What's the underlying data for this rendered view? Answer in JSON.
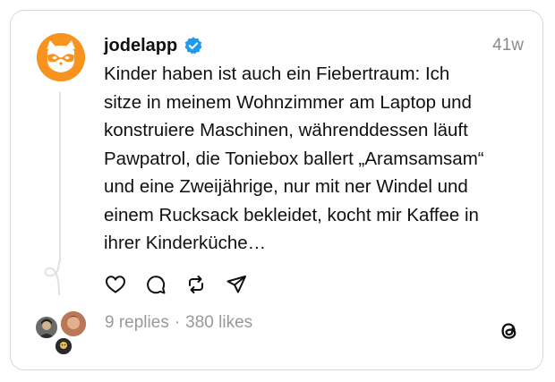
{
  "post": {
    "username": "jodelapp",
    "timestamp": "41w",
    "text": "Kinder haben ist auch ein Fiebertraum: Ich\nsitze in meinem Wohnzimmer am Laptop und\nkonstruiere Maschinen, währenddessen läuft\nPawpatrol, die Toniebox ballert „Aramsamsam“\nund eine Zweijährige, nur mit ner Windel und\neinem Rucksack bekleidet, kocht mir Kaffee in\nihrer Kinderküche…",
    "verified": true
  },
  "stats": {
    "replies": "9 replies",
    "separator": "·",
    "likes": "380 likes"
  },
  "icons": {
    "avatar": "raccoon-icon",
    "verified": "verified-badge-icon",
    "like": "heart-icon",
    "comment": "comment-icon",
    "repost": "repost-icon",
    "share": "send-icon",
    "brand": "threads-logo-icon"
  },
  "colors": {
    "avatar_bg": "#f7931e",
    "verified_blue": "#1d9bf0",
    "muted_text": "#999999",
    "border": "#d9d9d9"
  }
}
